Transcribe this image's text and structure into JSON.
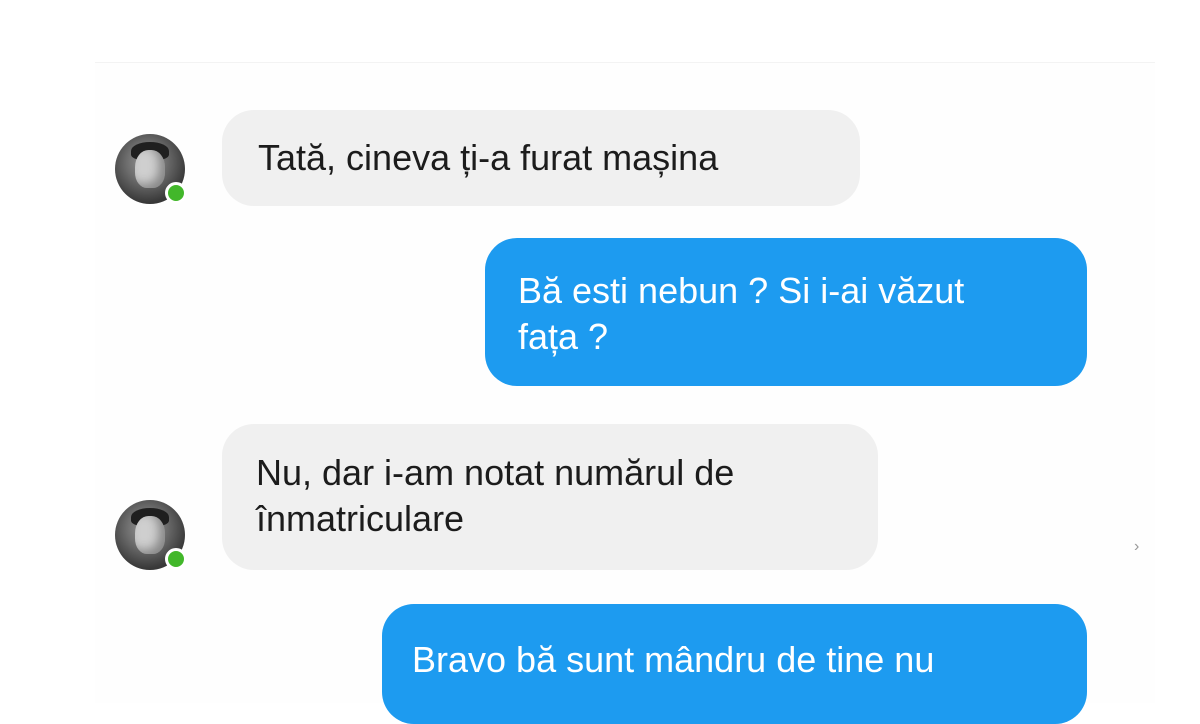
{
  "messages": [
    {
      "direction": "in",
      "text": "Tată, cineva ți-a furat mașina"
    },
    {
      "direction": "out",
      "text": "Bă esti nebun ? Si i-ai văzut\nfața  ?"
    },
    {
      "direction": "in",
      "text": "Nu, dar i-am notat numărul de\nînmatriculare"
    },
    {
      "direction": "out",
      "text": "Bravo bă sunt mândru de tine nu"
    }
  ],
  "contact": {
    "avatar_icon": "user-photo-icon",
    "online_status_color": "#42b72a"
  },
  "colors": {
    "incoming_bubble": "#f0f0f0",
    "outgoing_bubble": "#1d9bf0"
  }
}
